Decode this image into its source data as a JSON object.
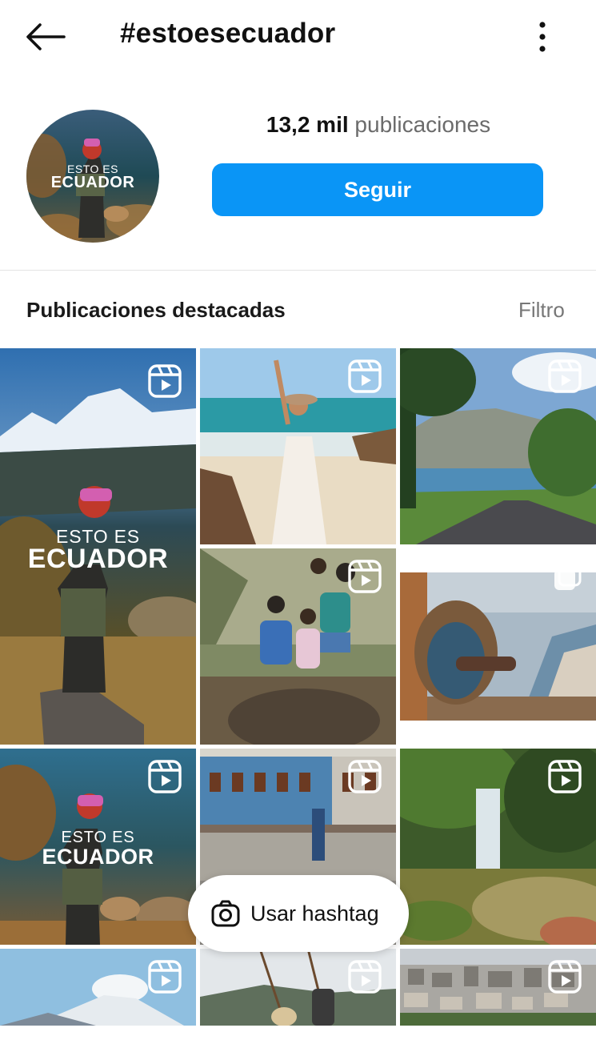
{
  "header": {
    "title": "#estoesecuador",
    "back_icon": "arrow-left-icon",
    "menu_icon": "more-vertical-icon"
  },
  "profile": {
    "avatar_text_line1": "ESTO ES",
    "avatar_text_line2": "ECUADOR",
    "posts_count": "13,2 mil",
    "posts_label": "publicaciones",
    "follow_label": "Seguir",
    "follow_color": "#0a95f6"
  },
  "section": {
    "title": "Publicaciones destacadas",
    "filter_label": "Filtro"
  },
  "posts": [
    {
      "kind": "reel",
      "badge_icon": "reel-icon",
      "overlay_line1": "ESTO ES",
      "overlay_line2": "ECUADOR"
    },
    {
      "kind": "reel",
      "badge_icon": "reel-icon"
    },
    {
      "kind": "reel",
      "badge_icon": "reel-icon"
    },
    {
      "kind": "reel",
      "badge_icon": "reel-icon"
    },
    {
      "kind": "carousel",
      "badge_icon": "carousel-icon"
    },
    {
      "kind": "reel",
      "badge_icon": "reel-icon",
      "overlay_line1": "ESTO ES",
      "overlay_line2": "ECUADOR"
    },
    {
      "kind": "reel",
      "badge_icon": "reel-icon"
    },
    {
      "kind": "reel",
      "badge_icon": "reel-icon"
    },
    {
      "kind": "reel",
      "badge_icon": "reel-icon"
    },
    {
      "kind": "reel",
      "badge_icon": "reel-icon"
    },
    {
      "kind": "reel",
      "badge_icon": "reel-icon"
    }
  ],
  "fab": {
    "label": "Usar hashtag",
    "icon": "camera-icon"
  }
}
